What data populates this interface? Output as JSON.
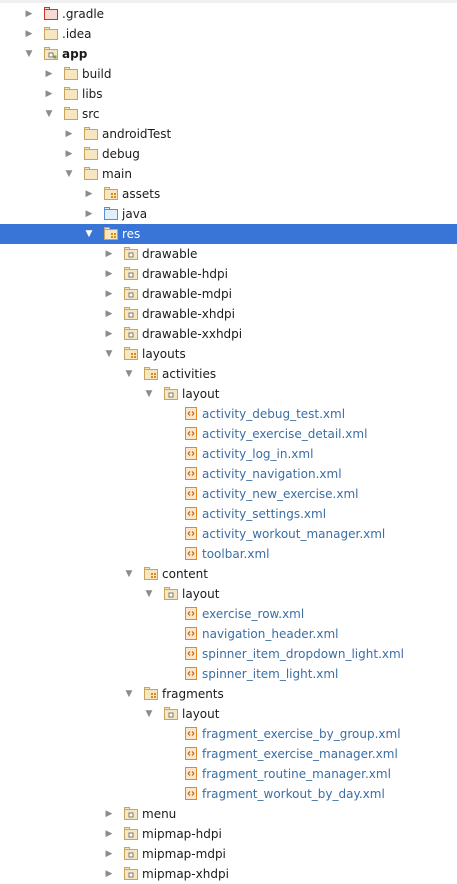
{
  "window": {
    "title": ""
  },
  "colors": {
    "selection": "#3875d7",
    "folder": "#c9a45c",
    "folder_red": "#c0392b",
    "folder_blue": "#5a8fd6",
    "xml_text": "#3b6ea5",
    "xml_icon": "#e0892a"
  },
  "tree": [
    {
      "label": ".gradle",
      "depth": 1,
      "state": "collapsed",
      "icon": "folder-excluded-icon"
    },
    {
      "label": ".idea",
      "depth": 1,
      "state": "collapsed",
      "icon": "folder-icon"
    },
    {
      "label": "app",
      "depth": 1,
      "state": "expanded",
      "icon": "module-folder-icon",
      "bold": true
    },
    {
      "label": "build",
      "depth": 2,
      "state": "collapsed",
      "icon": "folder-icon"
    },
    {
      "label": "libs",
      "depth": 2,
      "state": "collapsed",
      "icon": "folder-icon"
    },
    {
      "label": "src",
      "depth": 2,
      "state": "expanded",
      "icon": "folder-icon"
    },
    {
      "label": "androidTest",
      "depth": 3,
      "state": "collapsed",
      "icon": "folder-icon"
    },
    {
      "label": "debug",
      "depth": 3,
      "state": "collapsed",
      "icon": "folder-icon"
    },
    {
      "label": "main",
      "depth": 3,
      "state": "expanded",
      "icon": "folder-icon"
    },
    {
      "label": "assets",
      "depth": 4,
      "state": "collapsed",
      "icon": "resource-folder-icon"
    },
    {
      "label": "java",
      "depth": 4,
      "state": "collapsed",
      "icon": "source-folder-icon"
    },
    {
      "label": "res",
      "depth": 4,
      "state": "expanded",
      "icon": "resource-folder-icon",
      "selected": true
    },
    {
      "label": "drawable",
      "depth": 5,
      "state": "collapsed",
      "icon": "package-folder-icon"
    },
    {
      "label": "drawable-hdpi",
      "depth": 5,
      "state": "collapsed",
      "icon": "package-folder-icon"
    },
    {
      "label": "drawable-mdpi",
      "depth": 5,
      "state": "collapsed",
      "icon": "package-folder-icon"
    },
    {
      "label": "drawable-xhdpi",
      "depth": 5,
      "state": "collapsed",
      "icon": "package-folder-icon"
    },
    {
      "label": "drawable-xxhdpi",
      "depth": 5,
      "state": "collapsed",
      "icon": "package-folder-icon"
    },
    {
      "label": "layouts",
      "depth": 5,
      "state": "expanded",
      "icon": "resource-folder-icon"
    },
    {
      "label": "activities",
      "depth": 6,
      "state": "expanded",
      "icon": "resource-folder-icon"
    },
    {
      "label": "layout",
      "depth": 7,
      "state": "expanded",
      "icon": "package-folder-icon"
    },
    {
      "label": "activity_debug_test.xml",
      "depth": 8,
      "state": "leaf",
      "icon": "xml-file-icon",
      "xml": true
    },
    {
      "label": "activity_exercise_detail.xml",
      "depth": 8,
      "state": "leaf",
      "icon": "xml-file-icon",
      "xml": true
    },
    {
      "label": "activity_log_in.xml",
      "depth": 8,
      "state": "leaf",
      "icon": "xml-file-icon",
      "xml": true
    },
    {
      "label": "activity_navigation.xml",
      "depth": 8,
      "state": "leaf",
      "icon": "xml-file-icon",
      "xml": true
    },
    {
      "label": "activity_new_exercise.xml",
      "depth": 8,
      "state": "leaf",
      "icon": "xml-file-icon",
      "xml": true
    },
    {
      "label": "activity_settings.xml",
      "depth": 8,
      "state": "leaf",
      "icon": "xml-file-icon",
      "xml": true
    },
    {
      "label": "activity_workout_manager.xml",
      "depth": 8,
      "state": "leaf",
      "icon": "xml-file-icon",
      "xml": true
    },
    {
      "label": "toolbar.xml",
      "depth": 8,
      "state": "leaf",
      "icon": "xml-file-icon",
      "xml": true
    },
    {
      "label": "content",
      "depth": 6,
      "state": "expanded",
      "icon": "resource-folder-icon"
    },
    {
      "label": "layout",
      "depth": 7,
      "state": "expanded",
      "icon": "package-folder-icon"
    },
    {
      "label": "exercise_row.xml",
      "depth": 8,
      "state": "leaf",
      "icon": "xml-file-icon",
      "xml": true
    },
    {
      "label": "navigation_header.xml",
      "depth": 8,
      "state": "leaf",
      "icon": "xml-file-icon",
      "xml": true
    },
    {
      "label": "spinner_item_dropdown_light.xml",
      "depth": 8,
      "state": "leaf",
      "icon": "xml-file-icon",
      "xml": true
    },
    {
      "label": "spinner_item_light.xml",
      "depth": 8,
      "state": "leaf",
      "icon": "xml-file-icon",
      "xml": true
    },
    {
      "label": "fragments",
      "depth": 6,
      "state": "expanded",
      "icon": "resource-folder-icon"
    },
    {
      "label": "layout",
      "depth": 7,
      "state": "expanded",
      "icon": "package-folder-icon"
    },
    {
      "label": "fragment_exercise_by_group.xml",
      "depth": 8,
      "state": "leaf",
      "icon": "xml-file-icon",
      "xml": true
    },
    {
      "label": "fragment_exercise_manager.xml",
      "depth": 8,
      "state": "leaf",
      "icon": "xml-file-icon",
      "xml": true
    },
    {
      "label": "fragment_routine_manager.xml",
      "depth": 8,
      "state": "leaf",
      "icon": "xml-file-icon",
      "xml": true
    },
    {
      "label": "fragment_workout_by_day.xml",
      "depth": 8,
      "state": "leaf",
      "icon": "xml-file-icon",
      "xml": true
    },
    {
      "label": "menu",
      "depth": 5,
      "state": "collapsed",
      "icon": "package-folder-icon"
    },
    {
      "label": "mipmap-hdpi",
      "depth": 5,
      "state": "collapsed",
      "icon": "package-folder-icon"
    },
    {
      "label": "mipmap-mdpi",
      "depth": 5,
      "state": "collapsed",
      "icon": "package-folder-icon"
    },
    {
      "label": "mipmap-xhdpi",
      "depth": 5,
      "state": "collapsed",
      "icon": "package-folder-icon"
    }
  ]
}
